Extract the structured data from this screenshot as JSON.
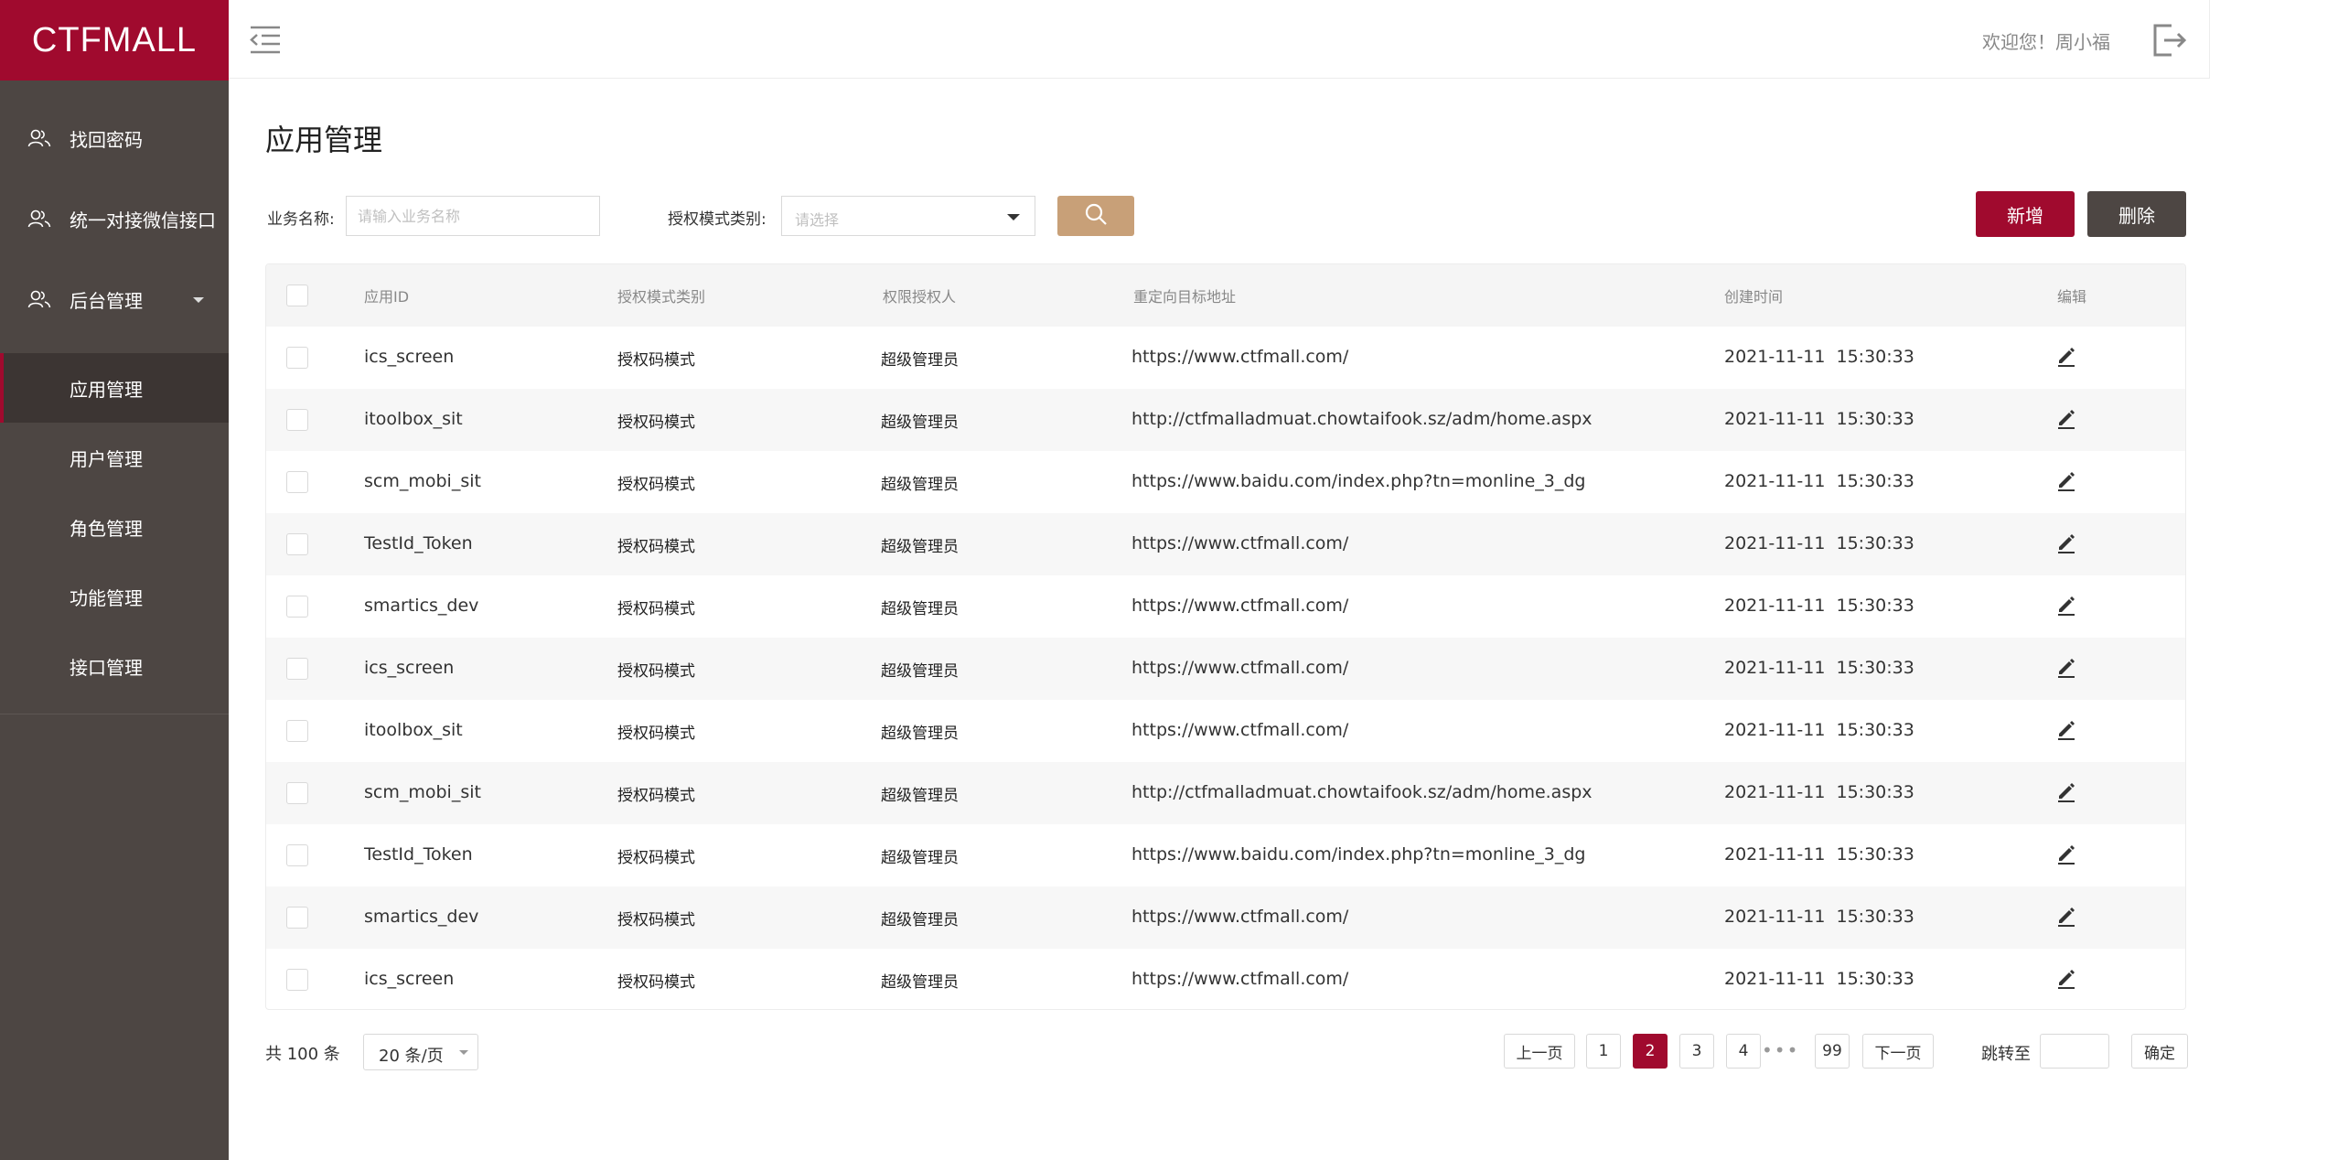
{
  "app": {
    "logo": "CTFMALL"
  },
  "sidebar": {
    "items": [
      {
        "label": "找回密码",
        "icon": "user-icon"
      },
      {
        "label": "统一对接微信接口",
        "icon": "user-icon"
      },
      {
        "label": "后台管理",
        "icon": "user-icon",
        "expanded": true
      }
    ],
    "sub_items": [
      {
        "label": "应用管理",
        "active": true
      },
      {
        "label": "用户管理"
      },
      {
        "label": "角色管理"
      },
      {
        "label": "功能管理"
      },
      {
        "label": "接口管理"
      }
    ]
  },
  "header": {
    "welcome": "欢迎您！周小福",
    "collapse_icon": "menu-collapse-icon",
    "logout_icon": "logout-icon"
  },
  "page": {
    "title": "应用管理"
  },
  "filters": {
    "business_name_label": "业务名称:",
    "business_name_placeholder": "请输入业务名称",
    "auth_mode_label": "授权模式类别:",
    "auth_mode_placeholder": "请选择",
    "search_icon": "search-icon"
  },
  "actions": {
    "add_label": "新增",
    "delete_label": "删除"
  },
  "table": {
    "columns": [
      "应用ID",
      "授权模式类别",
      "权限授权人",
      "重定向目标地址",
      "创建时间",
      "编辑"
    ],
    "rows": [
      {
        "app_id": "ics_screen",
        "mode": "授权码模式",
        "authorizer": "超级管理员",
        "redirect": "https://www.ctfmall.com/",
        "created": "2021-11-11  15:30:33"
      },
      {
        "app_id": "itoolbox_sit",
        "mode": "授权码模式",
        "authorizer": "超级管理员",
        "redirect": "http://ctfmalladmuat.chowtaifook.sz/adm/home.aspx",
        "created": "2021-11-11  15:30:33"
      },
      {
        "app_id": "scm_mobi_sit",
        "mode": "授权码模式",
        "authorizer": "超级管理员",
        "redirect": "https://www.baidu.com/index.php?tn=monline_3_dg",
        "created": "2021-11-11  15:30:33"
      },
      {
        "app_id": "TestId_Token",
        "mode": "授权码模式",
        "authorizer": "超级管理员",
        "redirect": "https://www.ctfmall.com/",
        "created": "2021-11-11  15:30:33"
      },
      {
        "app_id": "smartics_dev",
        "mode": "授权码模式",
        "authorizer": "超级管理员",
        "redirect": "https://www.ctfmall.com/",
        "created": "2021-11-11  15:30:33"
      },
      {
        "app_id": "ics_screen",
        "mode": "授权码模式",
        "authorizer": "超级管理员",
        "redirect": "https://www.ctfmall.com/",
        "created": "2021-11-11  15:30:33"
      },
      {
        "app_id": "itoolbox_sit",
        "mode": "授权码模式",
        "authorizer": "超级管理员",
        "redirect": "https://www.ctfmall.com/",
        "created": "2021-11-11  15:30:33"
      },
      {
        "app_id": "scm_mobi_sit",
        "mode": "授权码模式",
        "authorizer": "超级管理员",
        "redirect": "http://ctfmalladmuat.chowtaifook.sz/adm/home.aspx",
        "created": "2021-11-11  15:30:33"
      },
      {
        "app_id": "TestId_Token",
        "mode": "授权码模式",
        "authorizer": "超级管理员",
        "redirect": "https://www.baidu.com/index.php?tn=monline_3_dg",
        "created": "2021-11-11  15:30:33"
      },
      {
        "app_id": "smartics_dev",
        "mode": "授权码模式",
        "authorizer": "超级管理员",
        "redirect": "https://www.ctfmall.com/",
        "created": "2021-11-11  15:30:33"
      },
      {
        "app_id": "ics_screen",
        "mode": "授权码模式",
        "authorizer": "超级管理员",
        "redirect": "https://www.ctfmall.com/",
        "created": "2021-11-11  15:30:33"
      }
    ]
  },
  "pagination": {
    "total": "共 100 条",
    "page_size": "20 条/页",
    "prev": "上一页",
    "next": "下一页",
    "pages": [
      "1",
      "2",
      "3",
      "4",
      "99"
    ],
    "current": "2",
    "ellipsis": "•••",
    "goto_label": "跳转至",
    "confirm": "确定"
  },
  "colors": {
    "brand": "#a00a2e",
    "sidebar": "#4d4643",
    "search_button": "#c8a078"
  }
}
